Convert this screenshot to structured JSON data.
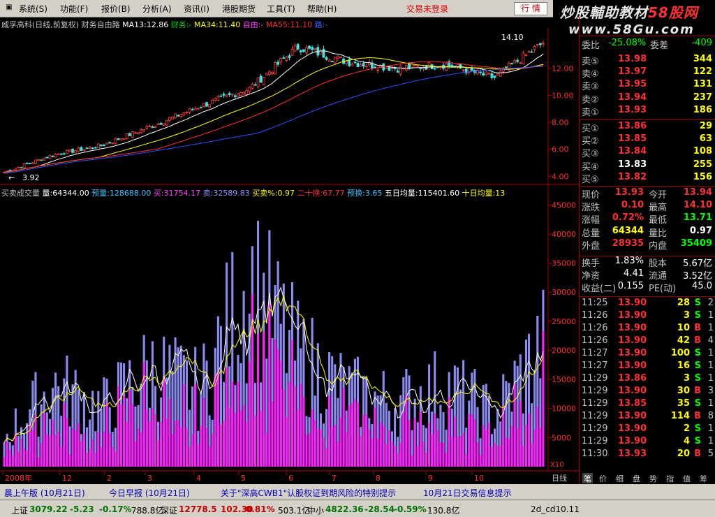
{
  "menu": {
    "items": [
      "系统(S)",
      "功能(F)",
      "报价(B)",
      "分析(A)",
      "资讯(I)",
      "港股期货",
      "工具(T)",
      "帮助(H)"
    ],
    "trade_status": "交易未登录",
    "quote_button": "行 情"
  },
  "brand": {
    "line1_a": "炒股輔助教材",
    "line1_b": "58股网",
    "line2": "www.58Gu.com"
  },
  "kline_header": {
    "name": "威孚高科(日线,前复权)",
    "formula": "财务自由路",
    "ma13": "MA13:12.86",
    "caiwu": "财务:-",
    "ma34": "MA34:11.40",
    "ziyou": "自由:-",
    "ma55": "MA55:11.10",
    "lu": "路:-"
  },
  "kline_axis": {
    "ticks": [
      "12.00",
      "10.00",
      "8.00",
      "6.00",
      "4.00"
    ],
    "high_label": "14.10",
    "low_label": "3.92"
  },
  "vol_header": {
    "name": "买卖成交量",
    "liang": "量:64344.00",
    "yuliang": "预量:128688.00",
    "mai": "买:31754.17",
    "maic": "卖:32589.83",
    "mmpct": "买卖%:0.97",
    "ershi": "二十换:67.77",
    "yuhuan": "预换:3.65",
    "wuri": "五日均量:115401.60",
    "shiri": "十日均量:13"
  },
  "vol_axis": {
    "ticks": [
      "45000",
      "40000",
      "35000",
      "30000",
      "25000",
      "20000",
      "15000",
      "10000",
      "5000"
    ],
    "unit": "X10"
  },
  "x_axis": {
    "labels": [
      "2008年",
      "12",
      "2",
      "3",
      "4",
      "5",
      "6",
      "7",
      "8",
      "9",
      "10"
    ],
    "period": "日线"
  },
  "chart_data": [
    {
      "type": "candlestick",
      "title": "威孚高科(日线,前复权)",
      "x": [
        "2008-11",
        "2008-12",
        "2009-01",
        "2009-02",
        "2009-03",
        "2009-04",
        "2009-05",
        "2009-06",
        "2009-07",
        "2009-08",
        "2009-09",
        "2009-10"
      ],
      "close": [
        4.3,
        5.6,
        6.3,
        7.7,
        9.2,
        10.5,
        13.6,
        12.5,
        12.0,
        12.3,
        11.3,
        13.9
      ],
      "ylim": [
        3.5,
        15.0
      ],
      "series_names": [
        "MA13",
        "MA34",
        "MA55"
      ]
    },
    {
      "type": "bar",
      "title": "买卖成交量",
      "x": [
        "2008-11",
        "2008-12",
        "2009-01",
        "2009-02",
        "2009-03",
        "2009-04",
        "2009-05",
        "2009-06",
        "2009-07",
        "2009-08",
        "2009-09",
        "2009-10"
      ],
      "values": [
        5000,
        14000,
        10000,
        17000,
        13000,
        32000,
        19000,
        13000,
        11000,
        14000,
        9000,
        21000
      ],
      "ylim": [
        0,
        46000
      ]
    }
  ],
  "quote": {
    "weibi_label": "委比",
    "weibi": "-25.08%",
    "weicha_label": "委差",
    "weicha": "-409",
    "asks": [
      {
        "label": "卖⑤",
        "price": "13.98",
        "vol": "344"
      },
      {
        "label": "卖④",
        "price": "13.97",
        "vol": "122"
      },
      {
        "label": "卖③",
        "price": "13.95",
        "vol": "131"
      },
      {
        "label": "卖②",
        "price": "13.94",
        "vol": "237"
      },
      {
        "label": "卖①",
        "price": "13.93",
        "vol": "186"
      }
    ],
    "bids": [
      {
        "label": "买①",
        "price": "13.86",
        "vol": "29"
      },
      {
        "label": "买②",
        "price": "13.85",
        "vol": "63"
      },
      {
        "label": "买③",
        "price": "13.84",
        "vol": "108"
      },
      {
        "label": "买④",
        "price": "13.83",
        "vol": "255"
      },
      {
        "label": "买⑤",
        "price": "13.82",
        "vol": "156"
      }
    ],
    "stats": [
      {
        "l1": "现价",
        "v1": "13.93",
        "l2": "今开",
        "v2": "13.94"
      },
      {
        "l1": "涨跌",
        "v1": "0.10",
        "l2": "最高",
        "v2": "14.10"
      },
      {
        "l1": "涨幅",
        "v1": "0.72%",
        "l2": "最低",
        "v2": "13.71"
      },
      {
        "l1": "总量",
        "v1": "64344",
        "l2": "量比",
        "v2": "0.97"
      },
      {
        "l1": "外盘",
        "v1": "28935",
        "l2": "内盘",
        "v2": "35409"
      }
    ],
    "stats2": [
      {
        "l1": "换手",
        "v1": "1.83%",
        "l2": "股本",
        "v2": "5.67亿"
      },
      {
        "l1": "净资",
        "v1": "4.41",
        "l2": "流通",
        "v2": "3.52亿"
      },
      {
        "l1": "收益(二)",
        "v1": "0.155",
        "l2": "PE(动)",
        "v2": "45.0"
      }
    ]
  },
  "ticks": [
    {
      "t": "11:25",
      "p": "13.90",
      "v": "28",
      "d": "S",
      "n": "2"
    },
    {
      "t": "11:26",
      "p": "13.90",
      "v": "3",
      "d": "S",
      "n": "1"
    },
    {
      "t": "11:26",
      "p": "13.90",
      "v": "10",
      "d": "B",
      "n": "1"
    },
    {
      "t": "11:26",
      "p": "13.90",
      "v": "42",
      "d": "B",
      "n": "4"
    },
    {
      "t": "11:27",
      "p": "13.90",
      "v": "100",
      "d": "S",
      "n": "1"
    },
    {
      "t": "11:27",
      "p": "13.90",
      "v": "16",
      "d": "S",
      "n": "1"
    },
    {
      "t": "11:29",
      "p": "13.86",
      "v": "3",
      "d": "S",
      "n": "1"
    },
    {
      "t": "11:29",
      "p": "13.90",
      "v": "30",
      "d": "B",
      "n": "3"
    },
    {
      "t": "11:29",
      "p": "13.85",
      "v": "35",
      "d": "S",
      "n": "1"
    },
    {
      "t": "11:29",
      "p": "13.90",
      "v": "114",
      "d": "B",
      "n": "8"
    },
    {
      "t": "11:29",
      "p": "13.90",
      "v": "2",
      "d": "S",
      "n": "1"
    },
    {
      "t": "11:29",
      "p": "13.90",
      "v": "4",
      "d": "S",
      "n": "1"
    },
    {
      "t": "11:30",
      "p": "13.93",
      "v": "20",
      "d": "B",
      "n": "5"
    }
  ],
  "panel_tabs": [
    "笔",
    "价",
    "细",
    "盘",
    "势",
    "指",
    "值",
    "筹"
  ],
  "news": [
    "晨上午版 (10月21日)",
    "今日早报 (10月21日)",
    "关于\"深高CWB1\"认股权证到期风险的特别提示",
    "10月21日交易信息提示"
  ],
  "index_bar": {
    "sh_name": "上证",
    "sh_val": "3079.22",
    "sh_chg": "-5.23",
    "sh_pct": "-0.17%",
    "sh_amt": "788.8亿",
    "sz_name": "深证",
    "sz_val": "12778.5",
    "sz_chg": "102.30",
    "sz_pct": "0.81%",
    "sz_amt": "503.1亿",
    "zx_name": "中小",
    "zx_val": "4822.36",
    "zx_chg": "-28.54",
    "zx_pct": "-0.59%",
    "zx_amt": "130.8亿",
    "code": "2d_cd10.11"
  }
}
